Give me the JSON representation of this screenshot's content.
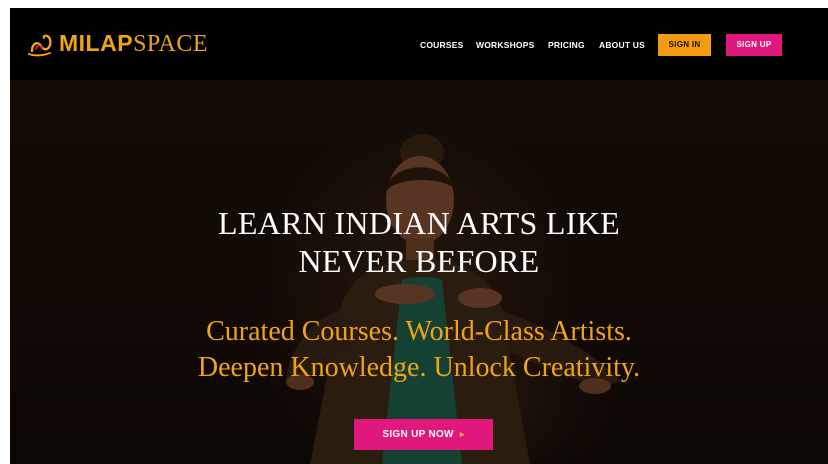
{
  "brand": {
    "logo_icon": "swan-icon",
    "name_bold": "MILAP",
    "name_light": "SPACE",
    "primary_color": "#f0a319",
    "accent_color": "#e0177c"
  },
  "nav": {
    "items": [
      {
        "label": "COURSES"
      },
      {
        "label": "WORKSHOPS"
      },
      {
        "label": "PRICING"
      },
      {
        "label": "ABOUT US"
      }
    ],
    "sign_in_label": "SIGN IN",
    "sign_up_label": "SIGN UP"
  },
  "hero": {
    "title_lines": [
      "LEARN INDIAN ARTS LIKE",
      "NEVER BEFORE"
    ],
    "subtitle_lines": [
      "Curated Courses. World-Class Artists.",
      "Deepen Knowledge. Unlock Creativity."
    ],
    "cta_label": "SIGN UP NOW",
    "cta_icon": "chevron-right-icon"
  }
}
